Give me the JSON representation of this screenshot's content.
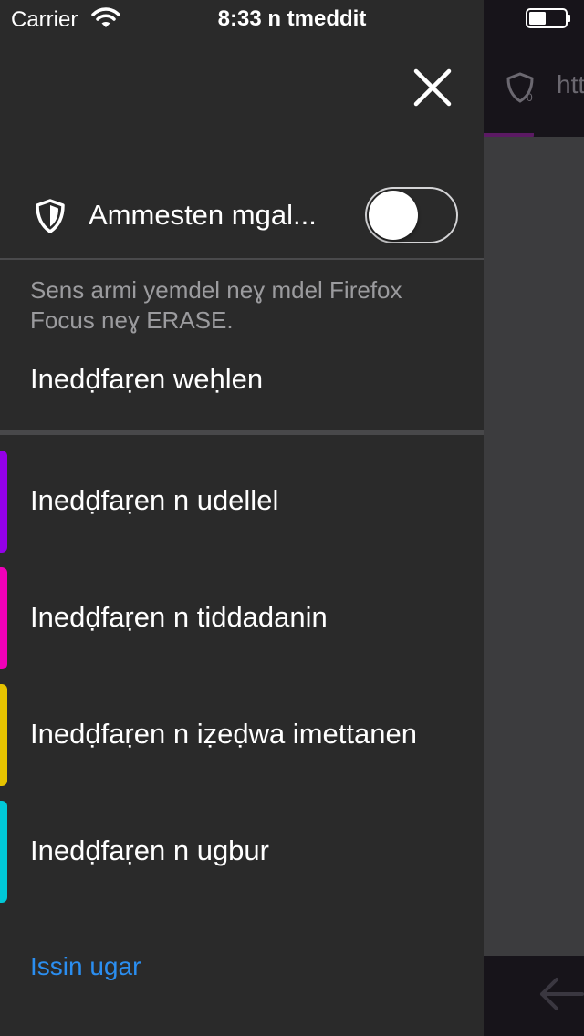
{
  "status_bar": {
    "carrier": "Carrier",
    "time": "8:33 n tmeddit"
  },
  "background": {
    "url_fragment": "htt"
  },
  "drawer": {
    "tracking_protection": {
      "label": "Ammesten mgal...",
      "toggle_on": false,
      "description": "Sens armi yemdel neɣ mdel Firefox Focus neɣ ERASE.",
      "learn_more": "Inedḍfaṛen weḥlen"
    },
    "trackers": [
      {
        "label": "Inedḍfaṛen n udellel",
        "color": "#9400e8"
      },
      {
        "label": "Inedḍfaṛen n tiddadanin",
        "color": "#f000b8"
      },
      {
        "label": "Inedḍfaṛen n iẓeḍwa imettanen",
        "color": "#e6c300"
      },
      {
        "label": "Inedḍfaṛen n ugbur",
        "color": "#00c8d7"
      }
    ],
    "see_all": "Issin ugar"
  },
  "colors": {
    "drawer_bg": "#2a2a2a",
    "link": "#2b8ef0",
    "secondary_text": "#9b9b9e"
  }
}
